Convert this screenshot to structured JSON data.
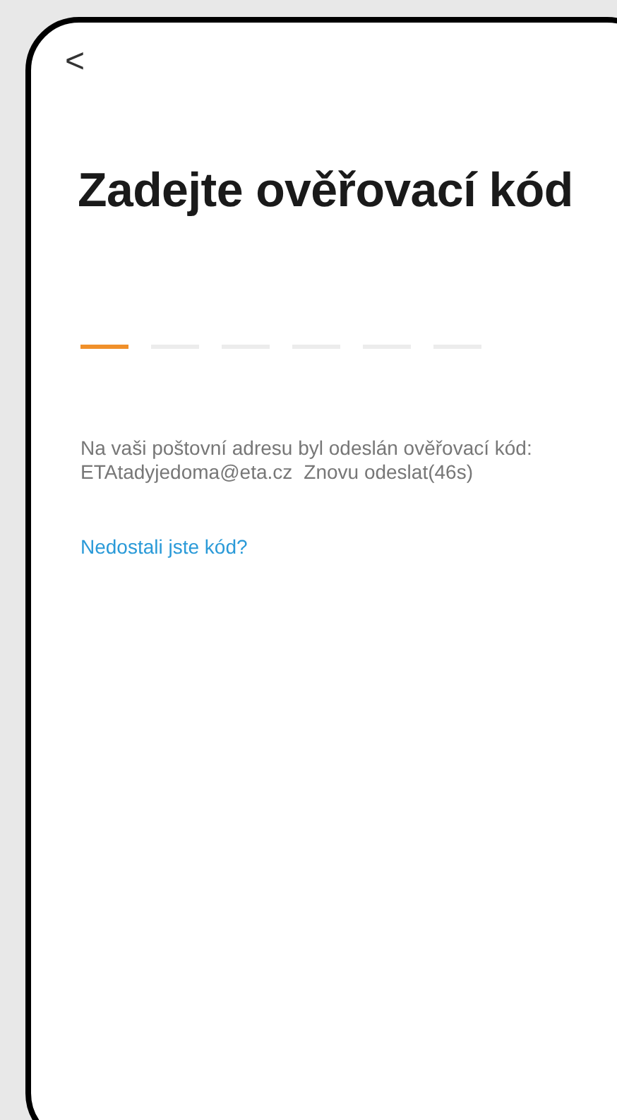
{
  "back": {
    "glyph": "<"
  },
  "title": "Zadejte ověřovací kód",
  "code_slots": [
    {
      "selected": true
    },
    {
      "selected": false
    },
    {
      "selected": false
    },
    {
      "selected": false
    },
    {
      "selected": false
    },
    {
      "selected": false
    }
  ],
  "message": "Na vaši poštovní adresu byl odeslán ověřovací kód:",
  "email": "ETAtadyjedoma@eta.cz",
  "resend": "Znovu odeslat(46s)",
  "help_link": "Nedostali jste kód?"
}
